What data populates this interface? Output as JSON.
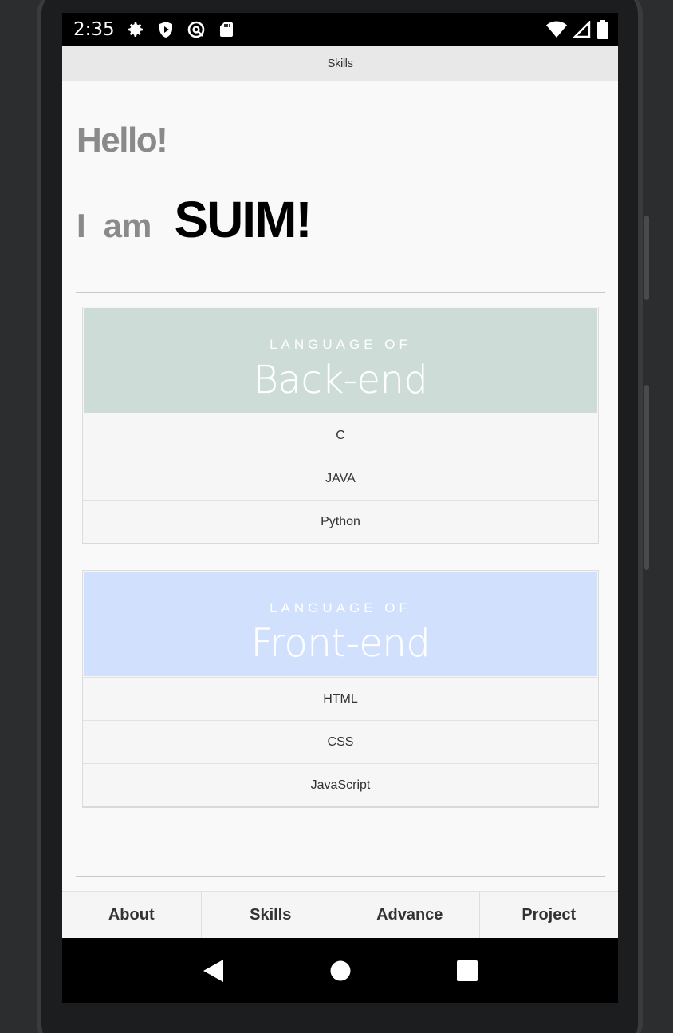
{
  "status_bar": {
    "time": "2:35",
    "icons": [
      "settings-icon",
      "shield-play-icon",
      "at-sign-icon",
      "sd-card-icon"
    ],
    "right_icons": [
      "wifi-icon",
      "signal-icon",
      "battery-icon"
    ]
  },
  "header": {
    "title": "Skills"
  },
  "greeting": {
    "hello": "Hello!",
    "i": "I",
    "am": "am",
    "name": "SUIM!"
  },
  "cards": [
    {
      "subtitle": "LANGUAGE OF",
      "title": "Back-end",
      "color": "#cddcd6",
      "items": [
        "C",
        "JAVA",
        "Python"
      ]
    },
    {
      "subtitle": "LANGUAGE OF",
      "title": "Front-end",
      "color": "#d1e0fd",
      "items": [
        "HTML",
        "CSS",
        "JavaScript"
      ]
    }
  ],
  "tabs": [
    {
      "label": "About"
    },
    {
      "label": "Skills"
    },
    {
      "label": "Advance"
    },
    {
      "label": "Project"
    }
  ],
  "nav_bar": {
    "icons": [
      "back-icon",
      "home-icon",
      "recents-icon"
    ]
  }
}
